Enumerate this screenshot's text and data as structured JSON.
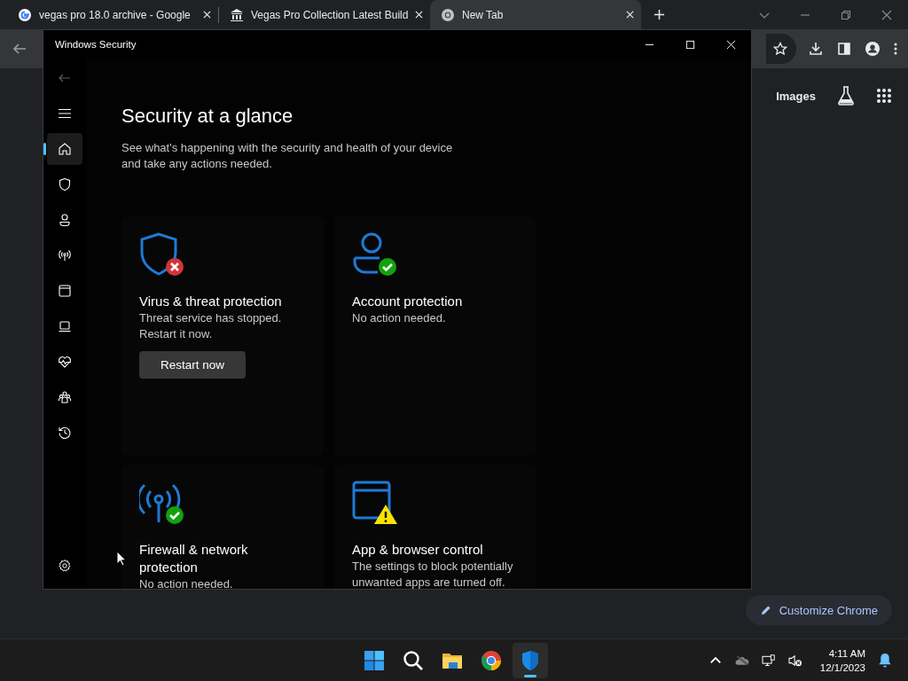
{
  "browser": {
    "tabs": [
      {
        "title": "vegas pro 18.0 archive - Google",
        "selected": false
      },
      {
        "title": "Vegas Pro Collection Latest Build",
        "selected": false
      },
      {
        "title": "New Tab",
        "selected": true
      }
    ],
    "links": [
      "Images"
    ],
    "customize_button": "Customize Chrome"
  },
  "window": {
    "title": "Windows Security",
    "nav": [
      {
        "kind": "home",
        "selected": true
      },
      {
        "kind": "shield",
        "selected": false
      },
      {
        "kind": "person",
        "selected": false
      },
      {
        "kind": "antenna",
        "selected": false
      },
      {
        "kind": "browser",
        "selected": false
      },
      {
        "kind": "laptop",
        "selected": false
      },
      {
        "kind": "health",
        "selected": false
      },
      {
        "kind": "family",
        "selected": false
      },
      {
        "kind": "history",
        "selected": false
      }
    ],
    "heading": "Security at a glance",
    "subtitle": "See what's happening with the security and health of your device and take any actions needed.",
    "cards": [
      {
        "kind": "virus",
        "title": "Virus & threat protection",
        "description": "Threat service has stopped. Restart it now.",
        "button": "Restart now"
      },
      {
        "kind": "account",
        "title": "Account protection",
        "description": "No action needed."
      },
      {
        "kind": "firewall",
        "title": "Firewall & network protection",
        "description": "No action needed."
      },
      {
        "kind": "app",
        "title": "App & browser control",
        "description": "The settings to block potentially unwanted apps are turned off."
      }
    ]
  },
  "taskbar": {
    "apps": [
      {
        "kind": "start",
        "selected": false
      },
      {
        "kind": "search",
        "selected": false
      },
      {
        "kind": "files",
        "selected": false
      },
      {
        "kind": "chrome",
        "selected": false
      },
      {
        "kind": "security",
        "selected": true
      }
    ],
    "time": "4:11 AM",
    "date": "12/1/2023"
  }
}
